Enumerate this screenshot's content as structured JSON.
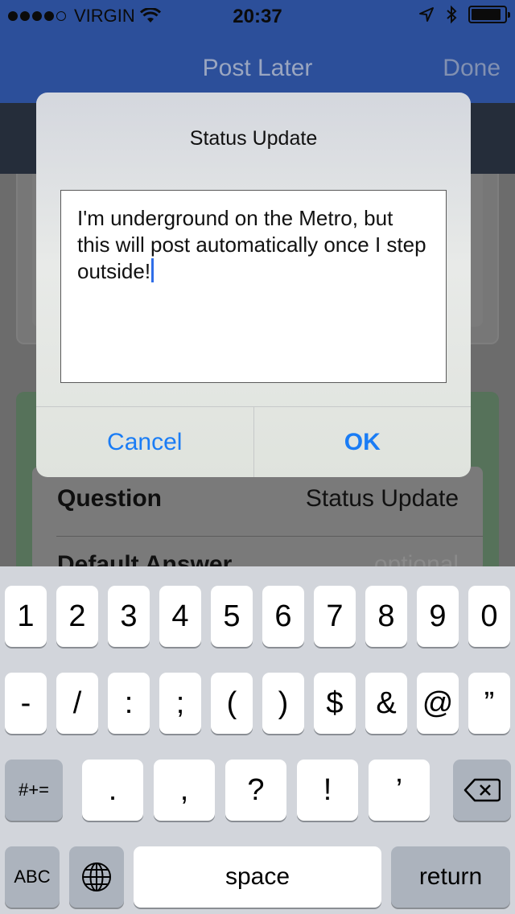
{
  "status_bar": {
    "carrier": "VIRGIN",
    "time": "20:37",
    "signal_bars": 4,
    "battery_level": 0.9
  },
  "nav": {
    "title": "Post Later",
    "done_label": "Done"
  },
  "background_form": {
    "question_label": "Question",
    "question_value": "Status Update",
    "default_answer_label": "Default Answer",
    "default_answer_placeholder": "optional"
  },
  "alert": {
    "title": "Status Update",
    "text": "I'm underground on the Metro, but this will post automatically once I step outside!",
    "cancel_label": "Cancel",
    "ok_label": "OK"
  },
  "keyboard": {
    "row1": [
      "1",
      "2",
      "3",
      "4",
      "5",
      "6",
      "7",
      "8",
      "9",
      "0"
    ],
    "row2": [
      "-",
      "/",
      ":",
      ";",
      "(",
      ")",
      "$",
      "&",
      "@",
      "”"
    ],
    "row3": [
      ".",
      ",",
      "?",
      "!",
      "’"
    ],
    "symbols_label": "#+=",
    "abc_label": "ABC",
    "space_label": "space",
    "return_label": "return",
    "icons": {
      "globe": "globe-icon",
      "delete": "backspace-icon"
    }
  },
  "colors": {
    "accent": "#1a7cf5",
    "nav_bar": "#2c4f9a",
    "keyboard_bg": "#d2d5db"
  }
}
